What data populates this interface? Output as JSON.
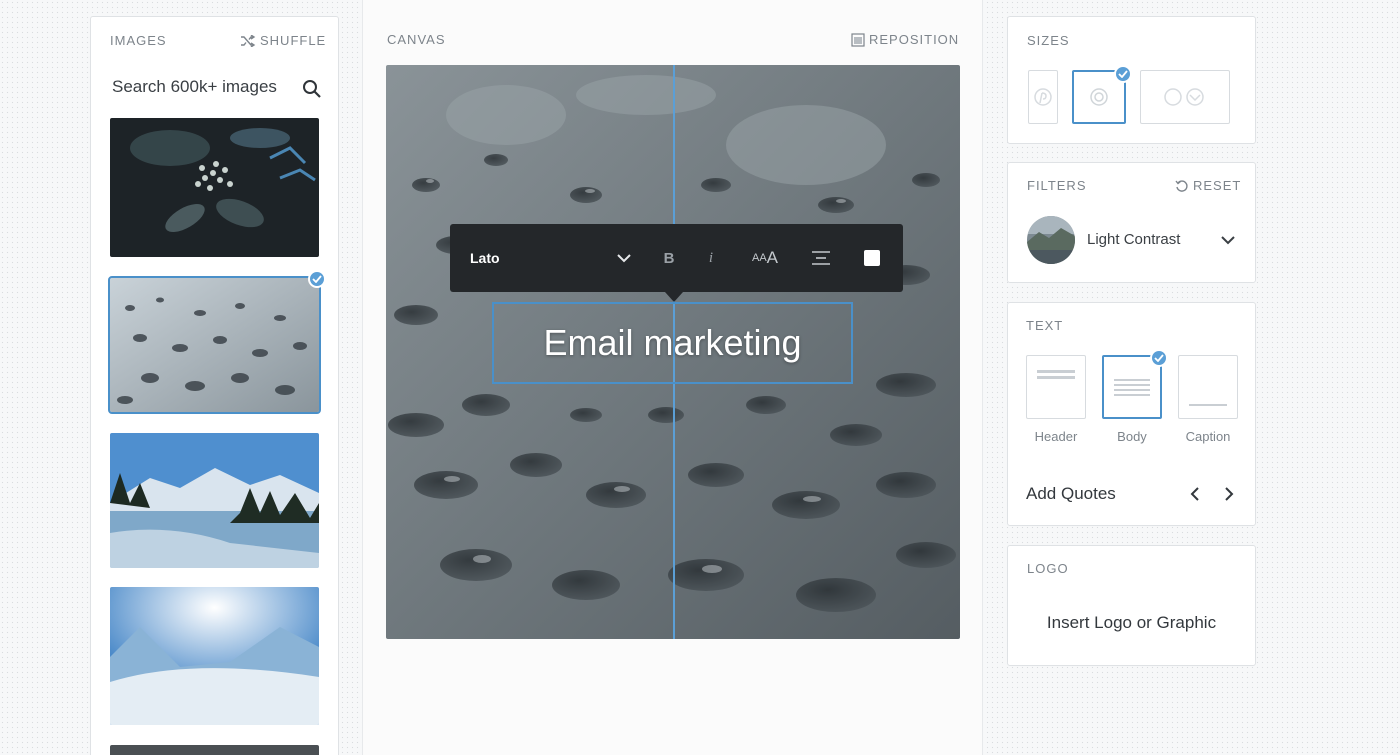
{
  "images_panel": {
    "title": "IMAGES",
    "shuffle_label": "SHUFFLE",
    "search_placeholder": "Search 600k+ images",
    "selected_index": 1
  },
  "canvas": {
    "title": "CANVAS",
    "reposition_label": "REPOSITION",
    "text": "Email marketing",
    "toolbar": {
      "font": "Lato",
      "bold_label": "B",
      "italic_label": "i",
      "size_label_small": "AA",
      "size_label_large": "A"
    }
  },
  "sizes": {
    "title": "SIZES",
    "options": [
      "pinterest",
      "square",
      "wide"
    ],
    "selected": "square"
  },
  "filters": {
    "title": "FILTERS",
    "reset_label": "RESET",
    "selected_filter": "Light Contrast"
  },
  "text_panel": {
    "title": "TEXT",
    "styles": [
      "Header",
      "Body",
      "Caption"
    ],
    "selected_style": "Body",
    "quotes_label": "Add Quotes"
  },
  "logo": {
    "title": "LOGO",
    "insert_label": "Insert Logo or Graphic"
  },
  "colors": {
    "accent": "#4a90c9",
    "toolbar_bg": "#24272a",
    "panel_border": "#dfe2e5"
  }
}
